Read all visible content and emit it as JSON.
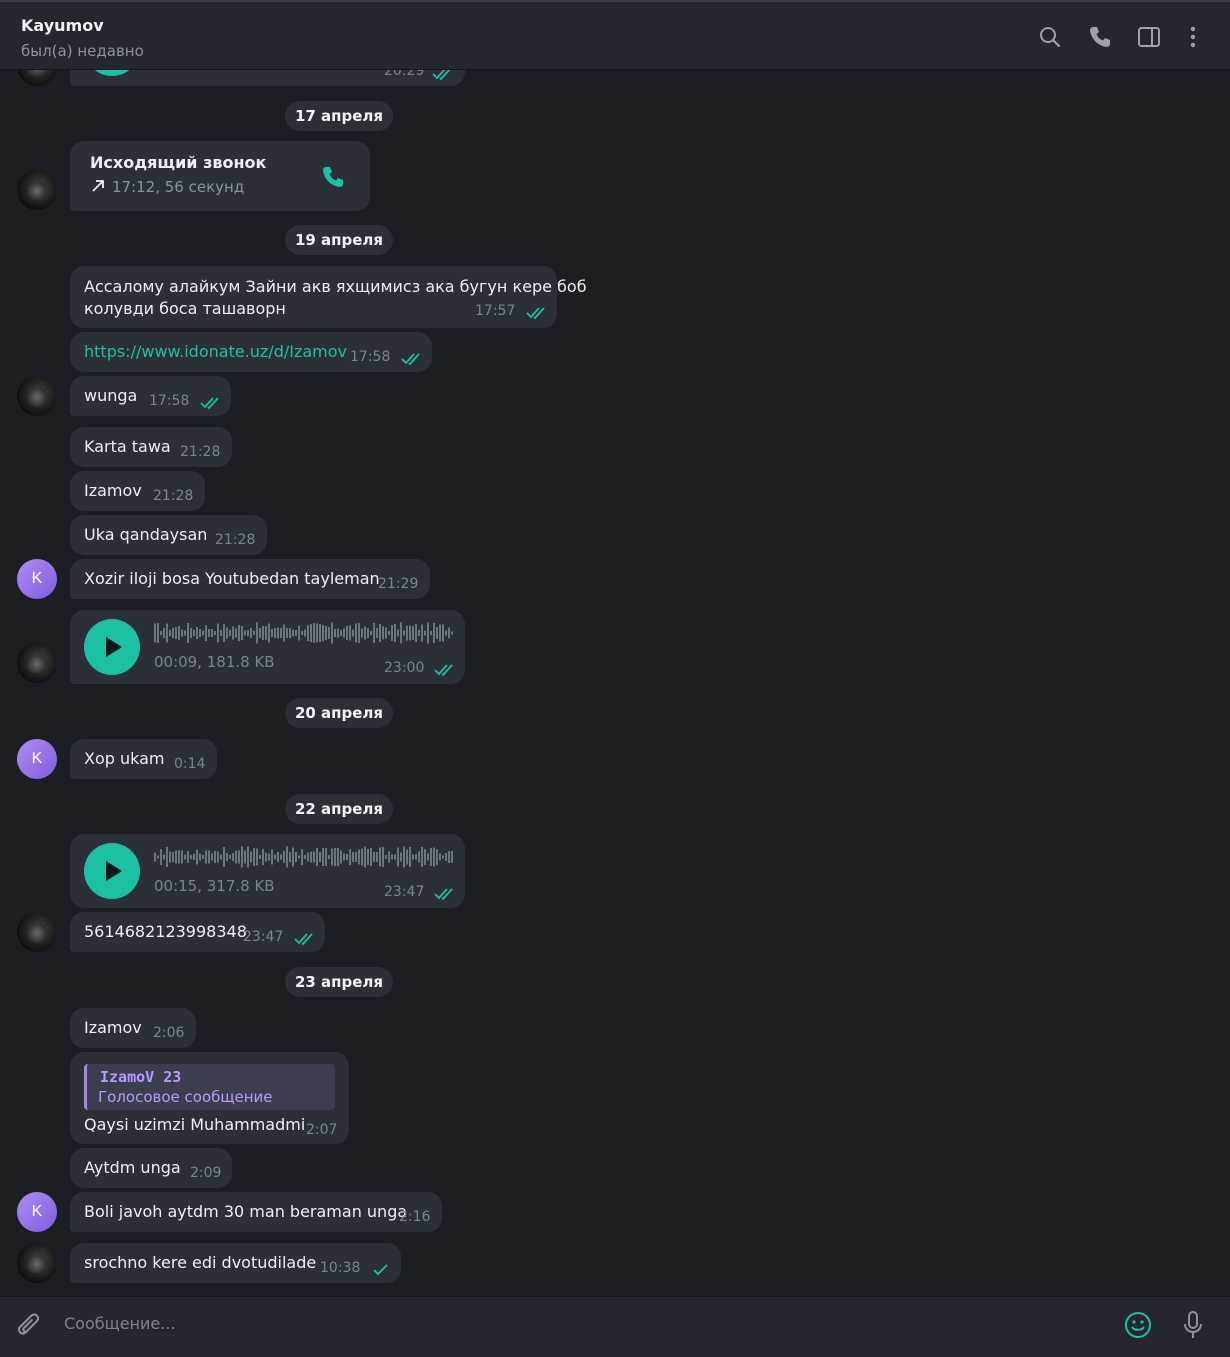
{
  "header": {
    "title": "Kayumov",
    "status": "был(а) недавно"
  },
  "messages": {
    "top_partial": {
      "time": "20:29"
    },
    "date_1": "17 апреля",
    "call": {
      "title": "Исходящий звонок",
      "detail": "17:12, 56 секунд"
    },
    "date_2": "19 апреля",
    "m1": {
      "line1": "Ассалому алайкум Зайни акв яхщимисз ака бугун кере боб",
      "line2": "колувди боса ташаворн",
      "time": "17:57"
    },
    "m2": {
      "text": "https://www.idonate.uz/d/Izamov",
      "time": "17:58"
    },
    "m3": {
      "text": "wunga",
      "time": "17:58"
    },
    "m4": {
      "text": "Karta tawa",
      "time": "21:28"
    },
    "m5": {
      "text": "Izamov",
      "time": "21:28"
    },
    "m6": {
      "text": "Uka qandaysan",
      "time": "21:28"
    },
    "m7": {
      "text": "Xozir iloji bosa Youtubedan tayleman",
      "time": "21:29"
    },
    "voice1": {
      "meta": "00:09, 181.8 KB",
      "time": "23:00"
    },
    "date_3": "20 апреля",
    "m8": {
      "text": "Xop ukam",
      "time": "0:14"
    },
    "date_4": "22 апреля",
    "voice2": {
      "meta": "00:15, 317.8 KB",
      "time": "23:47"
    },
    "m9": {
      "text": "5614682123998348",
      "time": "23:47"
    },
    "date_5": "23 апреля",
    "m10": {
      "text": "Izamov",
      "time": "2:06"
    },
    "m11": {
      "reply_name": "IzamoV 23",
      "reply_text": "Голосовое сообщение",
      "text": "Qaysi uzimzi Muhammadmi",
      "time": "2:07"
    },
    "m12": {
      "text": "Aytdm unga",
      "time": "2:09"
    },
    "m13": {
      "text": "Boli javoh aytdm 30 man beraman unga",
      "time": "2:16"
    },
    "m14": {
      "text": "srochno kere edi dvotudilade",
      "time": "10:38"
    }
  },
  "avatar_letter": "K",
  "composer": {
    "placeholder": "Сообщение..."
  },
  "colors": {
    "accent": "#1ec0a3",
    "bubble": "#2b3036",
    "background": "#1b1e22",
    "avatar": "#8e6be8"
  }
}
